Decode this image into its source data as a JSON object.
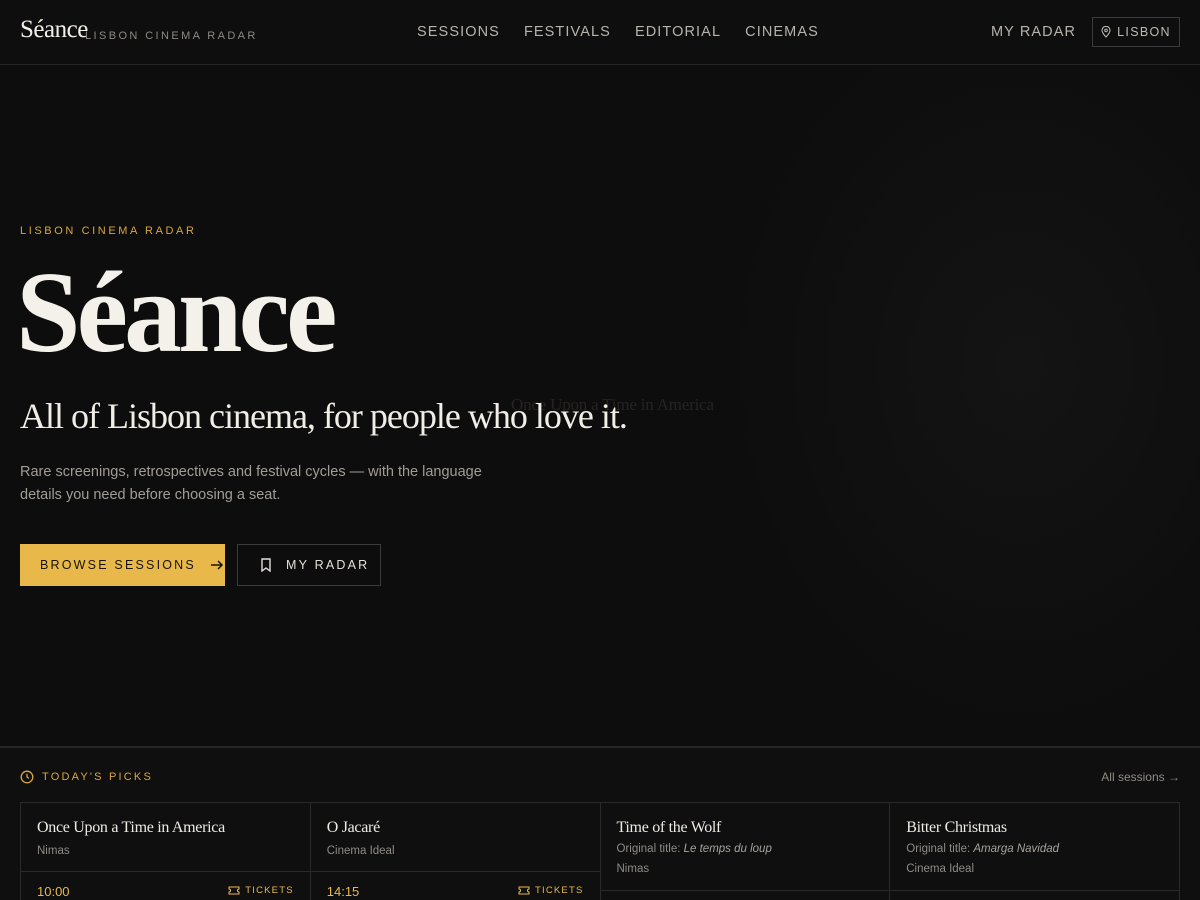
{
  "header": {
    "logo": "Séance",
    "tagline": "LISBON CINEMA RADAR",
    "nav": [
      "SESSIONS",
      "FESTIVALS",
      "EDITORIAL",
      "CINEMAS"
    ],
    "my_radar": "MY RADAR",
    "city": "LISBON"
  },
  "hero": {
    "eyebrow": "LISBON CINEMA RADAR",
    "title": "Séance",
    "subtitle": "All of Lisbon cinema, for people who love it.",
    "description": "Rare screenings, retrospectives and festival cycles — with the language details you need before choosing a seat.",
    "primary_cta": "BROWSE SESSIONS",
    "secondary_cta": "MY RADAR",
    "background_poster_title": "Once Upon a Time in America"
  },
  "picks": {
    "heading": "TODAY'S PICKS",
    "all_link": "All sessions →",
    "cards": [
      {
        "title": "Once Upon a Time in America",
        "venue": "Nimas",
        "time": "10:00",
        "tickets": "TICKETS"
      },
      {
        "title": "O Jacaré",
        "venue": "Cinema Ideal",
        "time": "14:15",
        "tickets": "TICKETS"
      },
      {
        "title": "Time of the Wolf",
        "original_label": "Original title:",
        "original_title": "Le temps du loup",
        "venue": "Nimas"
      },
      {
        "title": "Bitter Christmas",
        "original_label": "Original title:",
        "original_title": "Amarga Navidad",
        "venue": "Cinema Ideal"
      }
    ]
  },
  "colors": {
    "accent": "#e8b94a",
    "background": "#0b0b0b",
    "text": "#f2efe8"
  }
}
